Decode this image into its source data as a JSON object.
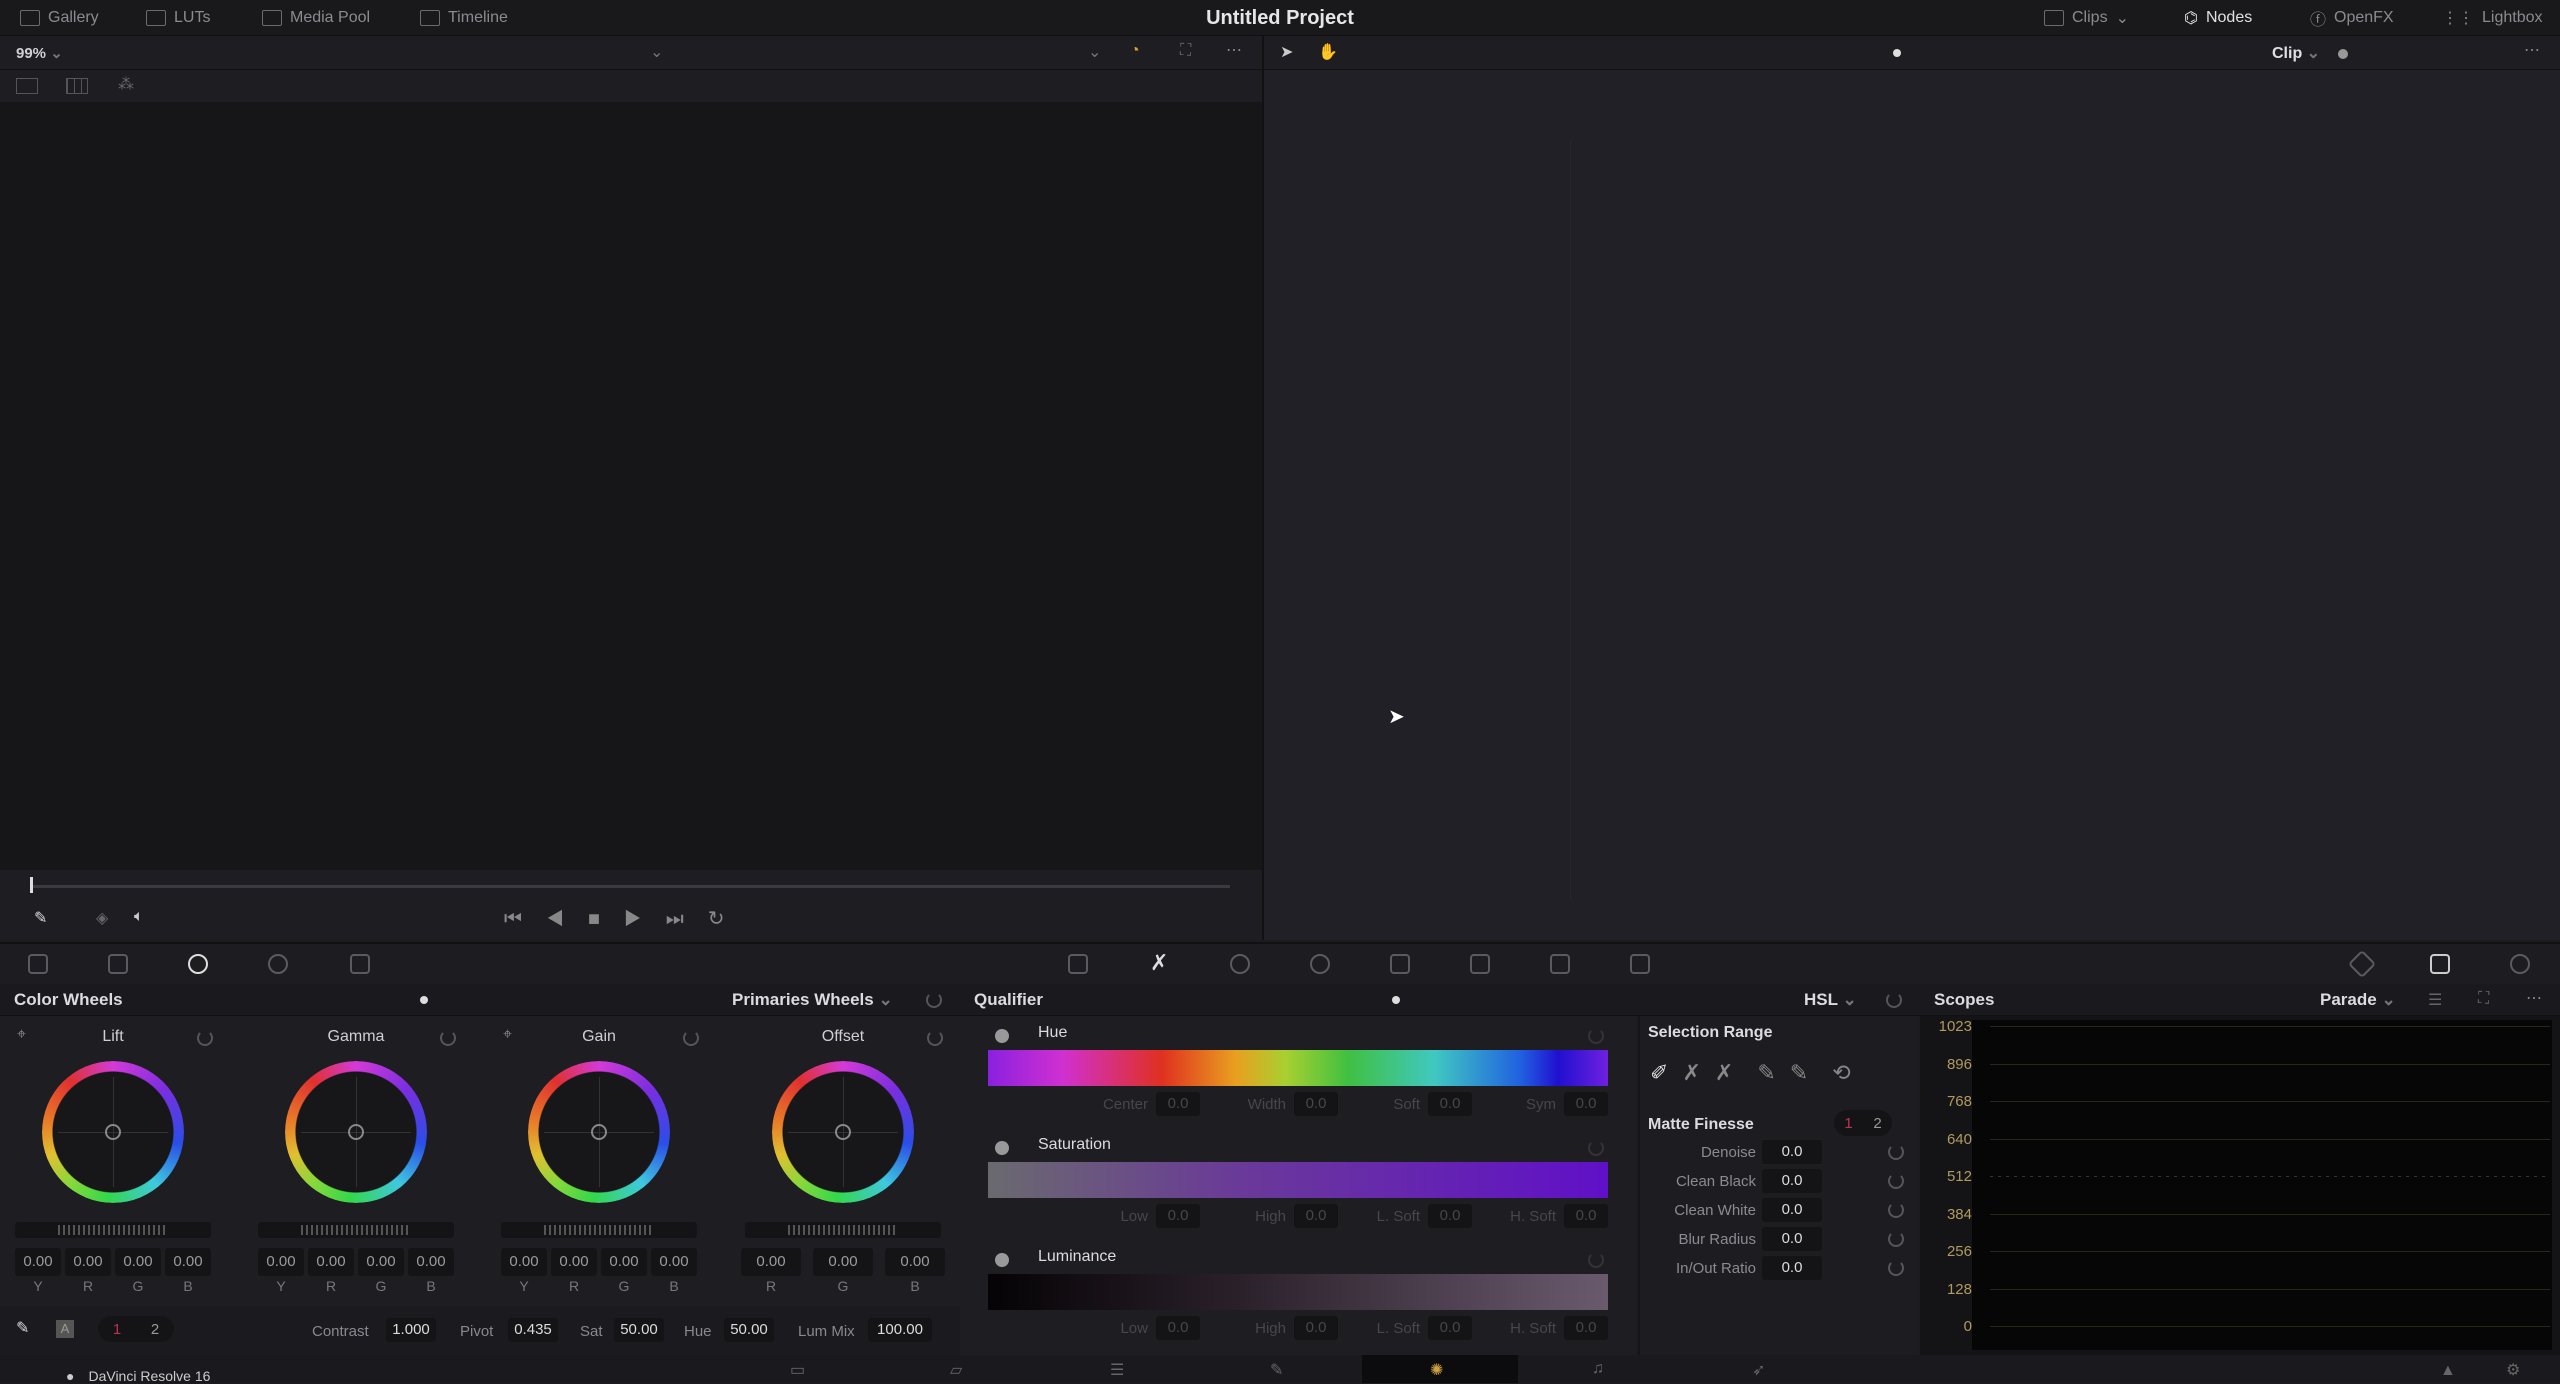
{
  "header": {
    "title": "Untitled Project",
    "left_tabs": [
      {
        "label": "Gallery",
        "icon": "gallery-icon"
      },
      {
        "label": "LUTs",
        "icon": "luts-icon"
      },
      {
        "label": "Media Pool",
        "icon": "media-pool-icon"
      },
      {
        "label": "Timeline",
        "icon": "timeline-icon"
      }
    ],
    "right_tabs": [
      {
        "label": "Clips",
        "icon": "clips-icon"
      },
      {
        "label": "Nodes",
        "icon": "nodes-icon"
      },
      {
        "label": "OpenFX",
        "icon": "fx-icon"
      },
      {
        "label": "Lightbox",
        "icon": "lightbox-icon"
      }
    ]
  },
  "viewer": {
    "zoom": "99%",
    "playhead_progress": 0
  },
  "nodes": {
    "mode": "Clip"
  },
  "color_wheels": {
    "title": "Color Wheels",
    "mode": "Primaries Wheels",
    "wheels": [
      {
        "label": "Lift",
        "values": [
          "0.00",
          "0.00",
          "0.00",
          "0.00"
        ],
        "channels": [
          "Y",
          "R",
          "G",
          "B"
        ]
      },
      {
        "label": "Gamma",
        "values": [
          "0.00",
          "0.00",
          "0.00",
          "0.00"
        ],
        "channels": [
          "Y",
          "R",
          "G",
          "B"
        ]
      },
      {
        "label": "Gain",
        "values": [
          "0.00",
          "0.00",
          "0.00",
          "0.00"
        ],
        "channels": [
          "Y",
          "R",
          "G",
          "B"
        ]
      },
      {
        "label": "Offset",
        "values": [
          "0.00",
          "0.00",
          "0.00"
        ],
        "channels": [
          "R",
          "G",
          "B"
        ]
      }
    ],
    "page1": "1",
    "page2": "2",
    "auto": "A",
    "params": [
      {
        "label": "Contrast",
        "value": "1.000"
      },
      {
        "label": "Pivot",
        "value": "0.435"
      },
      {
        "label": "Sat",
        "value": "50.00"
      },
      {
        "label": "Hue",
        "value": "50.00"
      },
      {
        "label": "Lum Mix",
        "value": "100.00"
      }
    ]
  },
  "qualifier": {
    "title": "Qualifier",
    "mode": "HSL",
    "sections": [
      {
        "label": "Hue",
        "fields": [
          {
            "label": "Center",
            "value": "0.0"
          },
          {
            "label": "Width",
            "value": "0.0"
          },
          {
            "label": "Soft",
            "value": "0.0"
          },
          {
            "label": "Sym",
            "value": "0.0"
          }
        ]
      },
      {
        "label": "Saturation",
        "fields": [
          {
            "label": "Low",
            "value": "0.0"
          },
          {
            "label": "High",
            "value": "0.0"
          },
          {
            "label": "L. Soft",
            "value": "0.0"
          },
          {
            "label": "H. Soft",
            "value": "0.0"
          }
        ]
      },
      {
        "label": "Luminance",
        "fields": [
          {
            "label": "Low",
            "value": "0.0"
          },
          {
            "label": "High",
            "value": "0.0"
          },
          {
            "label": "L. Soft",
            "value": "0.0"
          },
          {
            "label": "H. Soft",
            "value": "0.0"
          }
        ]
      }
    ]
  },
  "selection_range": {
    "title": "Selection Range",
    "matte_title": "Matte Finesse",
    "page1": "1",
    "page2": "2",
    "rows": [
      {
        "label": "Denoise",
        "value": "0.0"
      },
      {
        "label": "Clean Black",
        "value": "0.0"
      },
      {
        "label": "Clean White",
        "value": "0.0"
      },
      {
        "label": "Blur Radius",
        "value": "0.0"
      },
      {
        "label": "In/Out Ratio",
        "value": "0.0"
      }
    ]
  },
  "scopes": {
    "title": "Scopes",
    "mode": "Parade",
    "y_ticks": [
      "1023",
      "896",
      "768",
      "640",
      "512",
      "384",
      "256",
      "128",
      "0"
    ]
  },
  "footer": {
    "app": "DaVinci Resolve 16"
  }
}
